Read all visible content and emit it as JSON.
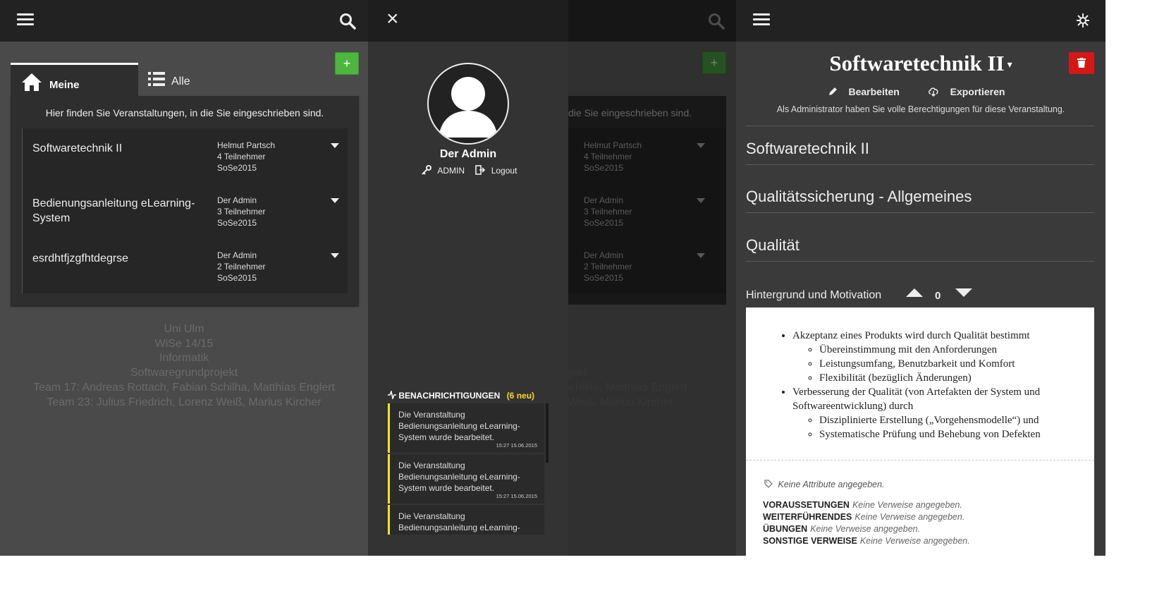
{
  "screen1": {
    "tabs": {
      "meine": "Meine",
      "alle": "Alle"
    },
    "intro": "Hier finden Sie Veranstaltungen, in die Sie eingeschrieben sind.",
    "add_label": "+",
    "courses": [
      {
        "title": "Softwaretechnik II",
        "owner": "Helmut Partsch",
        "participants": "4 Teilnehmer",
        "term": "SoSe2015"
      },
      {
        "title": "Bedienungsanleitung eLearning-System",
        "owner": "Der Admin",
        "participants": "3 Teilnehmer",
        "term": "SoSe2015"
      },
      {
        "title": "esrdhtfjzgfhtdegrse",
        "owner": "Der Admin",
        "participants": "2 Teilnehmer",
        "term": "SoSe2015"
      }
    ],
    "footer": [
      "Uni Ulm",
      "WiSe 14/15",
      "Informatik",
      "Softwaregrundprojekt",
      "Team 17: Andreas Rottach, Fabian Schilha, Matthias Englert",
      "Team 23: Julius Friedrich, Lorenz Weiß, Marius Kircher"
    ]
  },
  "screen2": {
    "close": "×",
    "add_label": "+",
    "intro_fragment": "die Sie eingeschrieben sind.",
    "courses": [
      {
        "owner": "Helmut Partsch",
        "participants": "4 Teilnehmer",
        "term": "SoSe2015"
      },
      {
        "owner": "Der Admin",
        "participants": "3 Teilnehmer",
        "term": "SoSe2015"
      },
      {
        "owner": "Der Admin",
        "participants": "2 Teilnehmer",
        "term": "SoSe2015"
      }
    ],
    "footer_fragments": [
      "15",
      "k",
      "projekt",
      "n Schilha, Matthias Englert",
      "nz Weiß, Marius Kircher"
    ],
    "user": {
      "name": "Der Admin",
      "role": "ADMIN",
      "logout": "Logout"
    },
    "notifications": {
      "heading": "BENACHRICHTIGUNGEN",
      "new_count": "(6 neu)",
      "items": [
        {
          "text": "Die Veranstaltung Bedienungsanleitung eLearning-System wurde bearbeitet.",
          "time": "15:27 15.06.2015"
        },
        {
          "text": "Die Veranstaltung Bedienungsanleitung eLearning-System wurde bearbeitet.",
          "time": "15:27 15.06.2015"
        },
        {
          "text": "Die Veranstaltung Bedienungsanleitung eLearning-",
          "time": ""
        }
      ]
    }
  },
  "screen3": {
    "title": "Softwaretechnik II",
    "edit": "Bearbeiten",
    "export": "Exportieren",
    "admin_note": "Als Administrator haben Sie volle Berechtigungen für diese Veranstaltung.",
    "sections": [
      "Softwaretechnik II",
      "Qualitätssicherung - Allgemeines",
      "Qualität"
    ],
    "subsection": "Hintergrund und Motivation",
    "votes": "0",
    "content": {
      "b1": "Akzeptanz eines Produkts wird durch Qualität bestimmt",
      "b1_sub": [
        "Übereinstimmung mit den Anforderungen",
        "Leistungsumfang, Benutzbarkeit und Komfort",
        "Flexibilität (bezüglich Änderungen)"
      ],
      "b2": "Verbesserung der Qualität (von Artefakten der System und Softwareentwicklung) durch",
      "b2_sub": [
        "Disziplinierte Erstellung („Vorgehensmodelle“) und",
        "Systematische Prüfung und Behebung von Defekten"
      ]
    },
    "attributes": "Keine Attribute angegeben.",
    "refs": [
      {
        "label": "VORAUSSETUNGEN",
        "value": "Keine Verweise angegeben."
      },
      {
        "label": "WEITERFÜHRENDES",
        "value": "Keine Verweise angegeben."
      },
      {
        "label": "ÜBUNGEN",
        "value": "Keine Verweise angegeben."
      },
      {
        "label": "SONSTIGE VERWEISE",
        "value": "Keine Verweise angegeben."
      }
    ]
  },
  "colors": {
    "accent_green": "#4cb63f",
    "danger_red": "#d41818",
    "notif_yellow": "#f0e431"
  }
}
